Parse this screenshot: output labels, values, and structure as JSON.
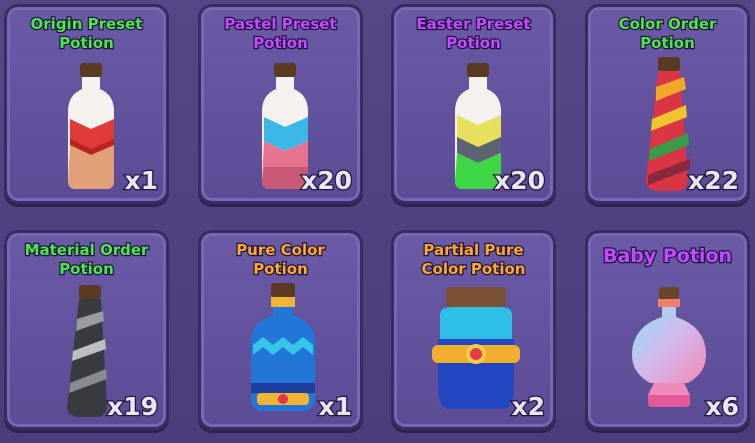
{
  "colors": {
    "green_title": "#4ce84a",
    "purple_title": "#c04bff",
    "orange_title": "#ffa928"
  },
  "potions": [
    {
      "title": "Origin Preset\nPotion",
      "count": "x1",
      "icon": "origin-preset-potion-icon"
    },
    {
      "title": "Pastel Preset\nPotion",
      "count": "x20",
      "icon": "pastel-preset-potion-icon"
    },
    {
      "title": "Easter Preset\nPotion",
      "count": "x20",
      "icon": "easter-preset-potion-icon"
    },
    {
      "title": "Color Order\nPotion",
      "count": "x22",
      "icon": "color-order-potion-icon"
    },
    {
      "title": "Material Order\nPotion",
      "count": "x19",
      "icon": "material-order-potion-icon"
    },
    {
      "title": "Pure Color\nPotion",
      "count": "x1",
      "icon": "pure-color-potion-icon"
    },
    {
      "title": "Partial Pure\nColor Potion",
      "count": "x2",
      "icon": "partial-pure-color-potion-icon"
    },
    {
      "title": "Baby Potion",
      "count": "x6",
      "icon": "baby-potion-icon"
    }
  ]
}
